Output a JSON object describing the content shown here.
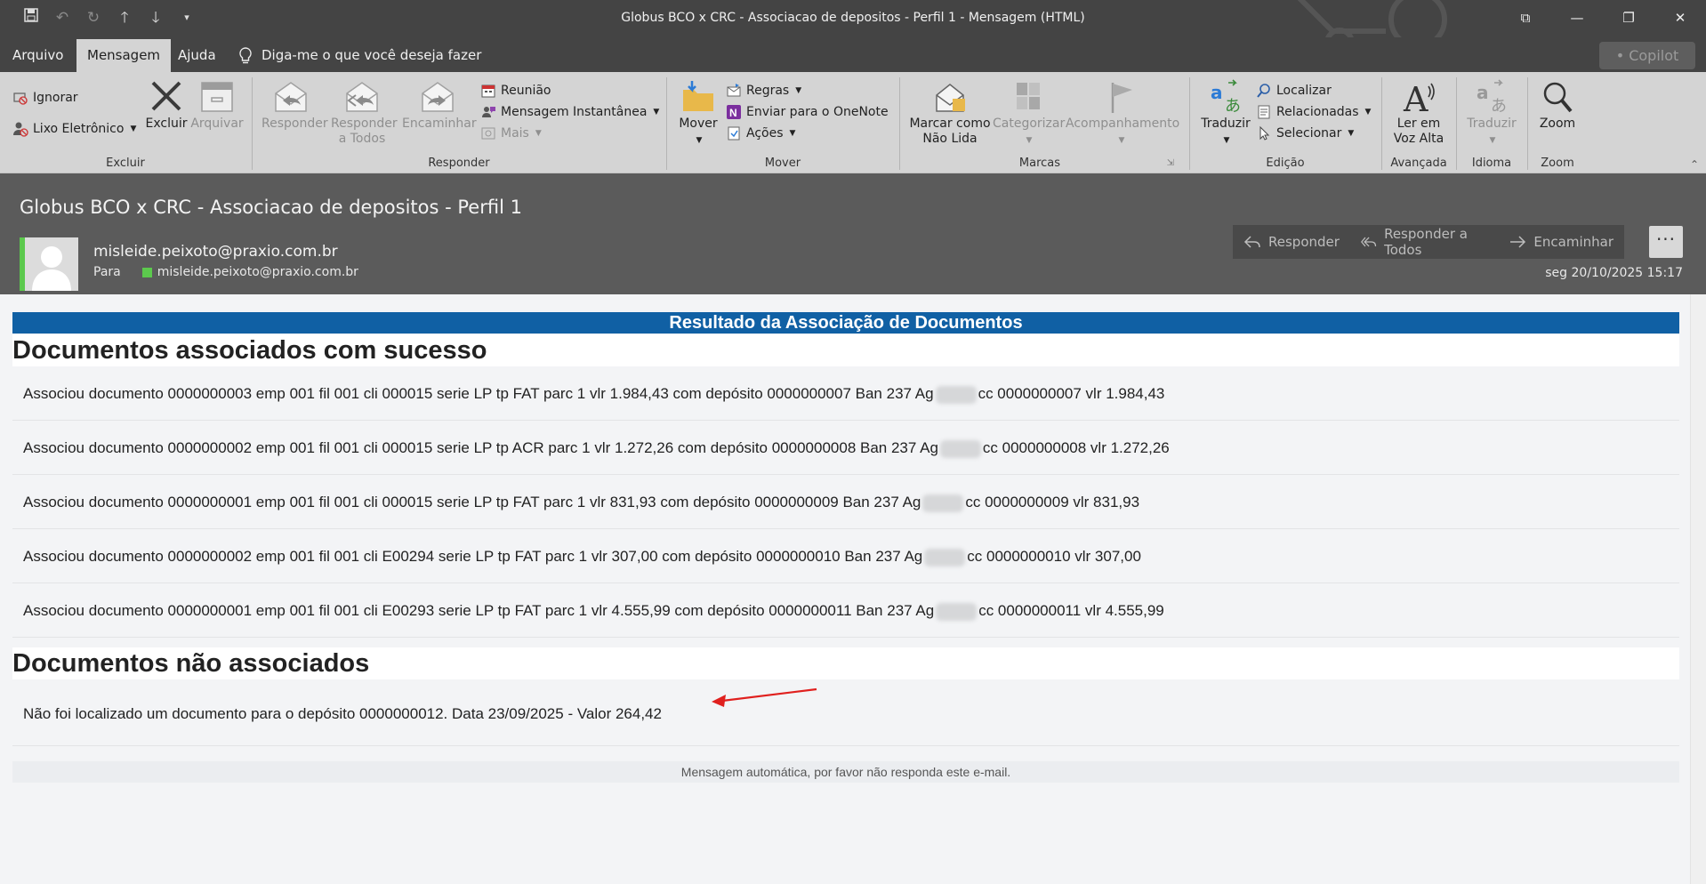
{
  "window": {
    "title": "Globus BCO x CRC - Associacao de depositos - Perfil 1  -  Mensagem (HTML)",
    "tabs": [
      {
        "label": "Arquivo",
        "active": false
      },
      {
        "label": "Mensagem",
        "active": true
      },
      {
        "label": "Ajuda",
        "active": false
      }
    ],
    "tell_me": "Diga-me o que você deseja fazer",
    "copilot": "Copilot"
  },
  "ribbon": {
    "groups": {
      "excluir": "Excluir",
      "responder": "Responder",
      "mover": "Mover",
      "marcas": "Marcas",
      "edicao": "Edição",
      "avancada": "Avançada",
      "idioma": "Idioma",
      "zoom": "Zoom"
    },
    "ignorar": "Ignorar",
    "lixo_eletronico": "Lixo Eletrônico",
    "excluir": "Excluir",
    "arquivar": "Arquivar",
    "responder": "Responder",
    "responder_todos_1": "Responder",
    "responder_todos_2": "a Todos",
    "encaminhar": "Encaminhar",
    "reuniao": "Reunião",
    "mensagem_instantanea": "Mensagem Instantânea",
    "mais": "Mais",
    "mover": "Mover",
    "regras": "Regras",
    "onenote": "Enviar para o OneNote",
    "acoes": "Ações",
    "marcar_1": "Marcar como",
    "marcar_2": "Não Lida",
    "categorizar": "Categorizar",
    "acompanhamento": "Acompanhamento",
    "traduzir": "Traduzir",
    "localizar": "Localizar",
    "relacionadas": "Relacionadas",
    "selecionar": "Selecionar",
    "ler_1": "Ler em",
    "ler_2": "Voz Alta",
    "traduzir_dis": "Traduzir",
    "zoom": "Zoom"
  },
  "header": {
    "subject": "Globus BCO x CRC - Associacao de depositos - Perfil 1",
    "sender": "misleide.peixoto@praxio.com.br",
    "to_label": "Para",
    "to_address": "misleide.peixoto@praxio.com.br",
    "date": "seg 20/10/2025 15:17",
    "actions": {
      "reply": "Responder",
      "reply_all": "Responder a Todos",
      "forward": "Encaminhar"
    }
  },
  "body": {
    "banner": "Resultado da Associação de Documentos",
    "success_title": "Documentos associados com sucesso",
    "success_rows": [
      {
        "before": "Associou documento 0000000003 emp 001 fil 001 cli 000015 serie LP tp FAT parc 1 vlr 1.984,43 com depósito 0000000007 Ban 237 Ag",
        "after": "cc 0000000007 vlr 1.984,43"
      },
      {
        "before": "Associou documento 0000000002 emp 001 fil 001 cli 000015 serie LP tp ACR parc 1 vlr 1.272,26 com depósito 0000000008 Ban 237 Ag",
        "after": "cc 0000000008 vlr 1.272,26"
      },
      {
        "before": "Associou documento 0000000001 emp 001 fil 001 cli 000015 serie LP tp FAT parc 1 vlr 831,93 com depósito 0000000009 Ban 237 Ag",
        "after": "cc 0000000009 vlr 831,93"
      },
      {
        "before": "Associou documento 0000000002 emp 001 fil 001 cli E00294 serie LP tp FAT parc 1 vlr 307,00 com depósito 0000000010 Ban 237 Ag",
        "after": "cc 0000000010 vlr 307,00"
      },
      {
        "before": "Associou documento 0000000001 emp 001 fil 001 cli E00293 serie LP tp FAT parc 1 vlr 4.555,99 com depósito 0000000011 Ban 237 Ag",
        "after": "cc 0000000011 vlr 4.555,99"
      }
    ],
    "failed_title": "Documentos não associados",
    "failed_row": "Não foi localizado um documento para o depósito 0000000012. Data 23/09/2025 - Valor 264,42",
    "footer": "Mensagem automática, por favor não responda este e-mail."
  },
  "colors": {
    "banner": "#1060a4",
    "presence": "#5cc94d",
    "annotation_arrow": "#e0201e"
  }
}
